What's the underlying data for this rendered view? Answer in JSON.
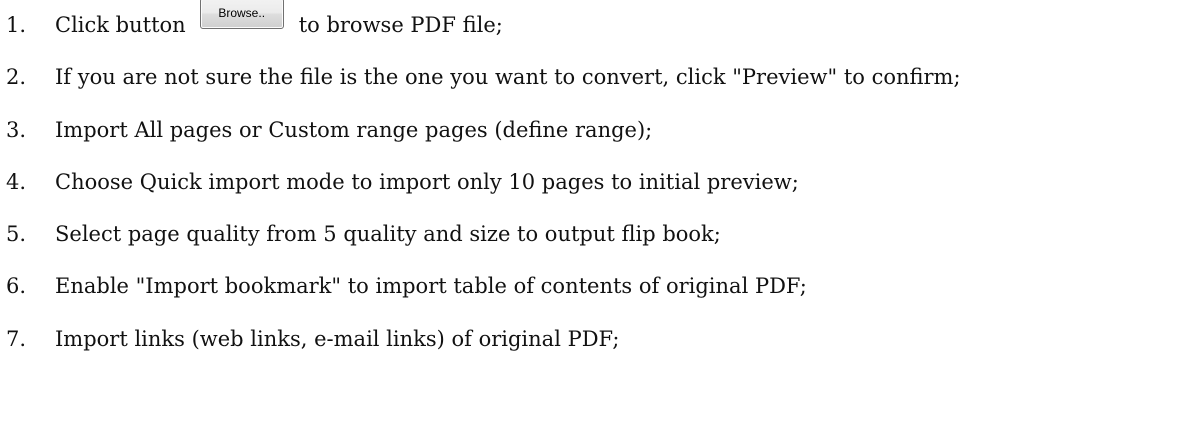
{
  "steps": [
    {
      "number": "1.",
      "text_before": "Click button",
      "button_label": "Browse..",
      "text_after": "to browse PDF file;"
    },
    {
      "number": "2.",
      "text": "If you are not sure the file is the one you want to convert, click \"Preview\" to confirm;"
    },
    {
      "number": "3.",
      "text": "Import All pages or Custom range pages (define range);"
    },
    {
      "number": "4.",
      "text": "Choose Quick import mode to import only 10 pages to initial preview;"
    },
    {
      "number": "5.",
      "text": "Select page quality from 5 quality and size to output flip book;"
    },
    {
      "number": "6.",
      "text": "Enable \"Import bookmark\" to import table of contents of original PDF;"
    },
    {
      "number": "7.",
      "text": "Import links (web links, e-mail links) of original PDF;"
    }
  ]
}
